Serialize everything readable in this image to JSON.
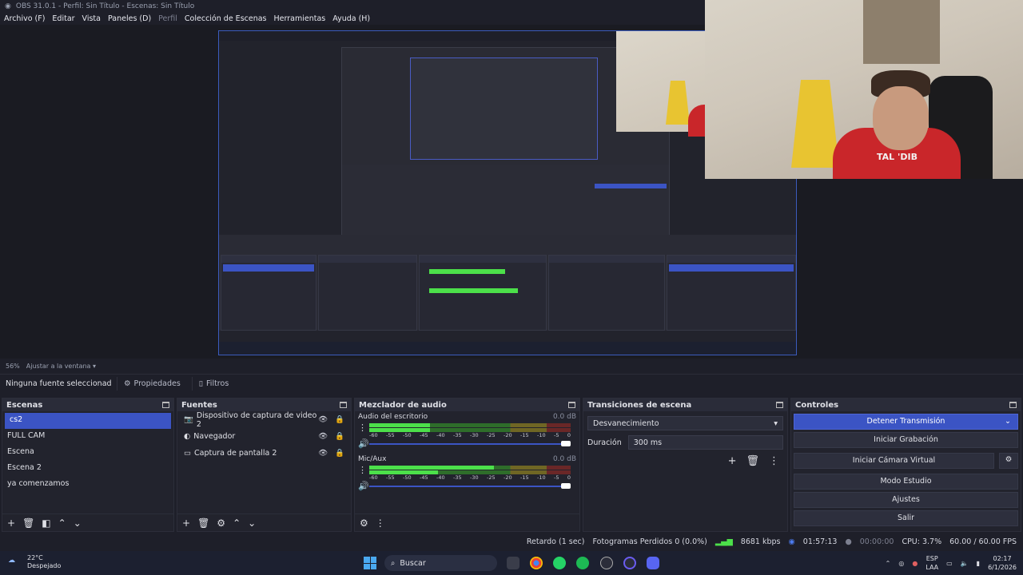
{
  "window": {
    "title": "OBS 31.0.1 - Perfil: Sin Título - Escenas: Sin Título"
  },
  "menu": [
    "Archivo (F)",
    "Editar",
    "Vista",
    "Paneles (D)",
    "Perfil",
    "Colección de Escenas",
    "Herramientas",
    "Ayuda (H)"
  ],
  "preview": {
    "zoom": "56%",
    "fit": "Ajustar a la ventana",
    "webcam_text": "TAL 'DIB"
  },
  "source_toolbar": {
    "no_source": "Ninguna fuente seleccionad",
    "properties": "Propiedades",
    "filters": "Filtros"
  },
  "scenes": {
    "title": "Escenas",
    "items": [
      "cs2",
      "FULL CAM",
      "Escena",
      "Escena 2",
      "ya comenzamos"
    ],
    "selected": 0
  },
  "sources": {
    "title": "Fuentes",
    "items": [
      {
        "label": "Dispositivo de captura de video 2",
        "icon": "camera-icon"
      },
      {
        "label": "Navegador",
        "icon": "globe-icon"
      },
      {
        "label": "Captura de pantalla 2",
        "icon": "monitor-icon"
      }
    ]
  },
  "mixer": {
    "title": "Mezclador de audio",
    "channels": [
      {
        "name": "Audio del escritorio",
        "db": "0.0 dB",
        "level": 0.3,
        "level2": 0.3
      },
      {
        "name": "Mic/Aux",
        "db": "0.0 dB",
        "level": 0.62,
        "level2": 0.34
      }
    ],
    "ticks": [
      "-60",
      "-55",
      "-50",
      "-45",
      "-40",
      "-35",
      "-30",
      "-25",
      "-20",
      "-15",
      "-10",
      "-5",
      "0"
    ]
  },
  "transitions": {
    "title": "Transiciones de escena",
    "selected": "Desvanecimiento",
    "duration_label": "Duración",
    "duration_value": "300 ms"
  },
  "controls": {
    "title": "Controles",
    "buttons": [
      "Detener Transmisión",
      "Iniciar Grabación",
      "Iniciar Cámara Virtual",
      "Modo Estudio",
      "Ajustes",
      "Salir"
    ]
  },
  "status": {
    "delay": "Retardo (1 sec)",
    "dropped": "Fotogramas Perdidos 0 (0.0%)",
    "bitrate": "8681 kbps",
    "stream_time": "01:57:13",
    "rec_time": "00:00:00",
    "cpu": "CPU: 3.7%",
    "fps": "60.00 / 60.00 FPS"
  },
  "taskbar": {
    "temp": "22°C",
    "weather": "Despejado",
    "search": "Buscar",
    "lang1": "ESP",
    "lang2": "LAA",
    "time": "02:17",
    "date": "6/1/2026"
  },
  "colors": {
    "accent": "#3b54c4",
    "bg": "#1e1f29",
    "panel": "#22232d"
  }
}
